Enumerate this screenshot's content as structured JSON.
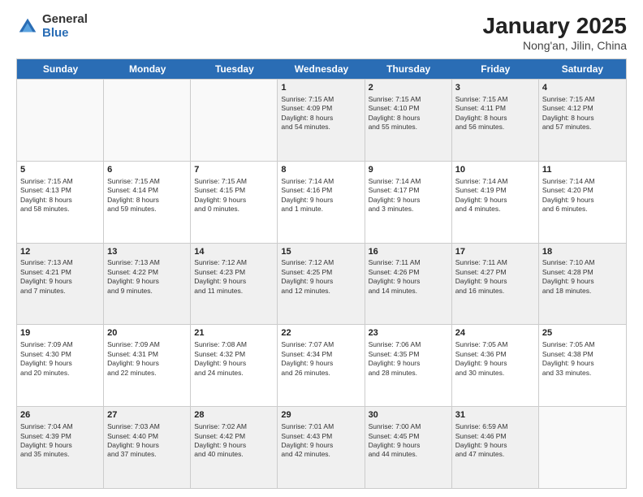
{
  "logo": {
    "general": "General",
    "blue": "Blue"
  },
  "title": {
    "month": "January 2025",
    "location": "Nong'an, Jilin, China"
  },
  "days": [
    "Sunday",
    "Monday",
    "Tuesday",
    "Wednesday",
    "Thursday",
    "Friday",
    "Saturday"
  ],
  "rows": [
    [
      {
        "day": "",
        "info": ""
      },
      {
        "day": "",
        "info": ""
      },
      {
        "day": "",
        "info": ""
      },
      {
        "day": "1",
        "info": "Sunrise: 7:15 AM\nSunset: 4:09 PM\nDaylight: 8 hours\nand 54 minutes."
      },
      {
        "day": "2",
        "info": "Sunrise: 7:15 AM\nSunset: 4:10 PM\nDaylight: 8 hours\nand 55 minutes."
      },
      {
        "day": "3",
        "info": "Sunrise: 7:15 AM\nSunset: 4:11 PM\nDaylight: 8 hours\nand 56 minutes."
      },
      {
        "day": "4",
        "info": "Sunrise: 7:15 AM\nSunset: 4:12 PM\nDaylight: 8 hours\nand 57 minutes."
      }
    ],
    [
      {
        "day": "5",
        "info": "Sunrise: 7:15 AM\nSunset: 4:13 PM\nDaylight: 8 hours\nand 58 minutes."
      },
      {
        "day": "6",
        "info": "Sunrise: 7:15 AM\nSunset: 4:14 PM\nDaylight: 8 hours\nand 59 minutes."
      },
      {
        "day": "7",
        "info": "Sunrise: 7:15 AM\nSunset: 4:15 PM\nDaylight: 9 hours\nand 0 minutes."
      },
      {
        "day": "8",
        "info": "Sunrise: 7:14 AM\nSunset: 4:16 PM\nDaylight: 9 hours\nand 1 minute."
      },
      {
        "day": "9",
        "info": "Sunrise: 7:14 AM\nSunset: 4:17 PM\nDaylight: 9 hours\nand 3 minutes."
      },
      {
        "day": "10",
        "info": "Sunrise: 7:14 AM\nSunset: 4:19 PM\nDaylight: 9 hours\nand 4 minutes."
      },
      {
        "day": "11",
        "info": "Sunrise: 7:14 AM\nSunset: 4:20 PM\nDaylight: 9 hours\nand 6 minutes."
      }
    ],
    [
      {
        "day": "12",
        "info": "Sunrise: 7:13 AM\nSunset: 4:21 PM\nDaylight: 9 hours\nand 7 minutes."
      },
      {
        "day": "13",
        "info": "Sunrise: 7:13 AM\nSunset: 4:22 PM\nDaylight: 9 hours\nand 9 minutes."
      },
      {
        "day": "14",
        "info": "Sunrise: 7:12 AM\nSunset: 4:23 PM\nDaylight: 9 hours\nand 11 minutes."
      },
      {
        "day": "15",
        "info": "Sunrise: 7:12 AM\nSunset: 4:25 PM\nDaylight: 9 hours\nand 12 minutes."
      },
      {
        "day": "16",
        "info": "Sunrise: 7:11 AM\nSunset: 4:26 PM\nDaylight: 9 hours\nand 14 minutes."
      },
      {
        "day": "17",
        "info": "Sunrise: 7:11 AM\nSunset: 4:27 PM\nDaylight: 9 hours\nand 16 minutes."
      },
      {
        "day": "18",
        "info": "Sunrise: 7:10 AM\nSunset: 4:28 PM\nDaylight: 9 hours\nand 18 minutes."
      }
    ],
    [
      {
        "day": "19",
        "info": "Sunrise: 7:09 AM\nSunset: 4:30 PM\nDaylight: 9 hours\nand 20 minutes."
      },
      {
        "day": "20",
        "info": "Sunrise: 7:09 AM\nSunset: 4:31 PM\nDaylight: 9 hours\nand 22 minutes."
      },
      {
        "day": "21",
        "info": "Sunrise: 7:08 AM\nSunset: 4:32 PM\nDaylight: 9 hours\nand 24 minutes."
      },
      {
        "day": "22",
        "info": "Sunrise: 7:07 AM\nSunset: 4:34 PM\nDaylight: 9 hours\nand 26 minutes."
      },
      {
        "day": "23",
        "info": "Sunrise: 7:06 AM\nSunset: 4:35 PM\nDaylight: 9 hours\nand 28 minutes."
      },
      {
        "day": "24",
        "info": "Sunrise: 7:05 AM\nSunset: 4:36 PM\nDaylight: 9 hours\nand 30 minutes."
      },
      {
        "day": "25",
        "info": "Sunrise: 7:05 AM\nSunset: 4:38 PM\nDaylight: 9 hours\nand 33 minutes."
      }
    ],
    [
      {
        "day": "26",
        "info": "Sunrise: 7:04 AM\nSunset: 4:39 PM\nDaylight: 9 hours\nand 35 minutes."
      },
      {
        "day": "27",
        "info": "Sunrise: 7:03 AM\nSunset: 4:40 PM\nDaylight: 9 hours\nand 37 minutes."
      },
      {
        "day": "28",
        "info": "Sunrise: 7:02 AM\nSunset: 4:42 PM\nDaylight: 9 hours\nand 40 minutes."
      },
      {
        "day": "29",
        "info": "Sunrise: 7:01 AM\nSunset: 4:43 PM\nDaylight: 9 hours\nand 42 minutes."
      },
      {
        "day": "30",
        "info": "Sunrise: 7:00 AM\nSunset: 4:45 PM\nDaylight: 9 hours\nand 44 minutes."
      },
      {
        "day": "31",
        "info": "Sunrise: 6:59 AM\nSunset: 4:46 PM\nDaylight: 9 hours\nand 47 minutes."
      },
      {
        "day": "",
        "info": ""
      }
    ]
  ]
}
